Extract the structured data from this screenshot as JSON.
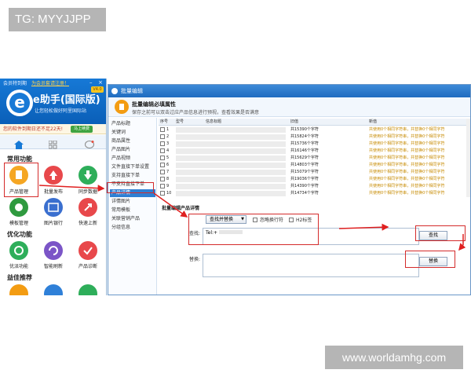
{
  "watermarks": {
    "top": "TG: MYYJJPP",
    "bottom": "www.worldamhg.com"
  },
  "left_app": {
    "top_bar": {
      "left": "会员特到期",
      "link": "为会员套请注册！"
    },
    "logo": {
      "brand": "e助手(国际版)",
      "slogan": "让您轻松做好阿里国际站",
      "version": "V4.0"
    },
    "notice": {
      "text": "您的软件到期日还不足22天!",
      "button": "马上续费"
    },
    "sections": [
      {
        "title": "常用功能",
        "items": [
          "产品管理",
          "批量发布",
          "同步数据",
          "模板管理",
          "图片银行",
          "快速上新"
        ]
      },
      {
        "title": "优化功能",
        "items": [
          "优派功能",
          "智能刷新",
          "产品诊断"
        ]
      },
      {
        "title": "益佳推荐",
        "items": []
      }
    ],
    "colors": {
      "header": "#1779d6",
      "accent": "#f39c12"
    }
  },
  "dialog": {
    "title": "批量编辑",
    "header_title": "批量编辑必填属性",
    "header_desc": "保存之前可以双击过应产品信息进行预视，查看效果是否满意",
    "nav": [
      "产品标题",
      "关键词",
      "商品属性",
      "产品图片",
      "产品视频",
      "文件直接下单设置",
      "支持直接下单",
      "不支持直接下单",
      "产品详情",
      "详情图片",
      "常用模板",
      "关联营销产品",
      "分组信息"
    ],
    "active_nav": 8,
    "table": {
      "headers": [
        "序号",
        "型号",
        "信息标题",
        "旧值",
        "新值"
      ],
      "rows": [
        {
          "no": "1",
          "old": "共15390个字符",
          "new": "共使用0个相同字符串，共替换0个相同字符"
        },
        {
          "no": "2",
          "old": "共15824个字符",
          "new": "共使用0个相同字符串，共替换0个相同字符"
        },
        {
          "no": "3",
          "old": "共15736个字符",
          "new": "共使用0个相同字符串，共替换0个相同字符"
        },
        {
          "no": "4",
          "old": "共16146个字符",
          "new": "共使用0个相同字符串，共替换0个相同字符"
        },
        {
          "no": "5",
          "old": "共15629个字符",
          "new": "共使用0个相同字符串，共替换0个相同字符"
        },
        {
          "no": "6",
          "old": "共14803个字符",
          "new": "共使用0个相同字符串，共替换0个相同字符"
        },
        {
          "no": "7",
          "old": "共15079个字符",
          "new": "共使用0个相同字符串，共替换0个相同字符"
        },
        {
          "no": "8",
          "old": "共19036个字符",
          "new": "共使用0个相同字符串，共替换0个相同字符"
        },
        {
          "no": "9",
          "old": "共14390个字符",
          "new": "共使用0个相同字符串，共替换0个相同字符"
        },
        {
          "no": "10",
          "old": "共14734个字符",
          "new": "共使用0个相同字符串，共替换0个相同字符"
        }
      ]
    },
    "batch_section": "批量编辑产品详情",
    "mode_select": "查找并替换",
    "options": [
      "忽略换行符",
      "H2标签"
    ],
    "find_label": "查找:",
    "find_value": "Tel:+",
    "find_button": "查找",
    "replace_label": "替换:",
    "replace_value": "",
    "replace_button": "替换",
    "colors": {
      "title_bar": "#2f7fd3",
      "highlight": "#2f7fd3",
      "new_value_text": "#c78a00",
      "annotation": "#d42b2b"
    }
  }
}
